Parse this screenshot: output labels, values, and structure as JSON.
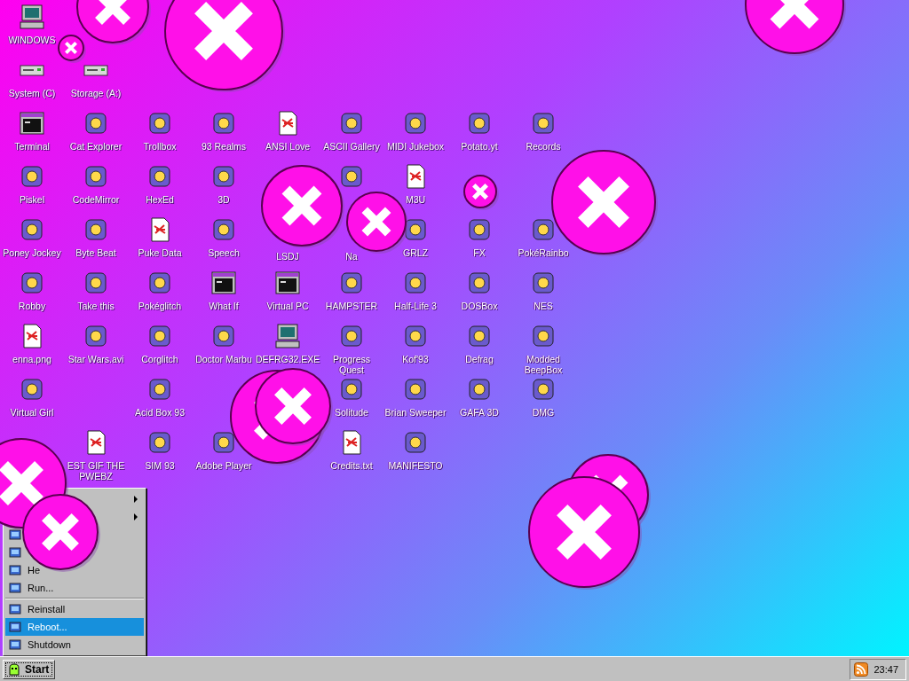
{
  "desktop": {
    "rows": [
      [
        {
          "label": "WINDOWS",
          "kind": "computer"
        }
      ],
      [
        {
          "label": "System (C)",
          "kind": "drive"
        },
        {
          "label": "Storage (A:)",
          "kind": "drive"
        }
      ],
      [
        {
          "label": "Terminal",
          "kind": "window"
        },
        {
          "label": "Cat Explorer",
          "kind": "app"
        },
        {
          "label": "Trollbox",
          "kind": "app"
        },
        {
          "label": "93 Realms",
          "kind": "app"
        },
        {
          "label": "ANSI Love",
          "kind": "document"
        },
        {
          "label": "ASCII Gallery",
          "kind": "app"
        },
        {
          "label": "MIDI Jukebox",
          "kind": "app"
        },
        {
          "label": "Potato.yt",
          "kind": "app"
        },
        {
          "label": "Records",
          "kind": "app"
        }
      ],
      [
        {
          "label": "Piskel",
          "kind": "app"
        },
        {
          "label": "CodeMirror",
          "kind": "app"
        },
        {
          "label": "HexEd",
          "kind": "app"
        },
        {
          "label": "3D",
          "kind": "app"
        },
        null,
        {
          "kind": "app"
        },
        {
          "label": "M3U",
          "kind": "document"
        },
        null,
        null
      ],
      [
        {
          "label": "Poney Jockey",
          "kind": "app"
        },
        {
          "label": "Byte Beat",
          "kind": "app"
        },
        {
          "label": "Puke Data",
          "kind": "document"
        },
        {
          "label": "Speech",
          "kind": "app"
        },
        {
          "label": "LSDJ",
          "kind": "none"
        },
        {
          "label": "Na",
          "kind": "none"
        },
        {
          "label": "GRLZ",
          "kind": "app"
        },
        {
          "label": "FX",
          "kind": "app"
        },
        {
          "label": "PokéRainbo",
          "kind": "app"
        }
      ],
      [
        {
          "label": "Robby",
          "kind": "app"
        },
        {
          "label": "Take this",
          "kind": "app"
        },
        {
          "label": "Pokéglitch",
          "kind": "app"
        },
        {
          "label": "What If",
          "kind": "window"
        },
        {
          "label": "Virtual PC",
          "kind": "window"
        },
        {
          "label": "HAMPSTER",
          "kind": "app"
        },
        {
          "label": "Half-Life 3",
          "kind": "app"
        },
        {
          "label": "DOSBox",
          "kind": "app"
        },
        {
          "label": "NES",
          "kind": "app"
        }
      ],
      [
        {
          "label": "enna.png",
          "kind": "document"
        },
        {
          "label": "Star Wars.avi",
          "kind": "app"
        },
        {
          "label": "Corglitch",
          "kind": "app"
        },
        {
          "label": "Doctor Marbu",
          "kind": "app"
        },
        {
          "label": "DEFRG32.EXE",
          "kind": "computer"
        },
        {
          "label": "Progress Quest",
          "kind": "app"
        },
        {
          "label": "Kof'93",
          "kind": "app"
        },
        {
          "label": "Defrag",
          "kind": "app"
        },
        {
          "label": "Modded BeepBox",
          "kind": "app"
        }
      ],
      [
        {
          "label": "Virtual Girl",
          "kind": "app"
        },
        null,
        {
          "label": "Acid Box 93",
          "kind": "app"
        },
        null,
        null,
        {
          "label": "Solitude",
          "kind": "app"
        },
        {
          "label": "Brian Sweeper",
          "kind": "app"
        },
        {
          "label": "GAFA 3D",
          "kind": "app"
        },
        {
          "label": "DMG",
          "kind": "app"
        }
      ],
      [
        null,
        {
          "label": "EST GIF THE PWEBZ",
          "kind": "document"
        },
        {
          "label": "SIM 93",
          "kind": "app"
        },
        {
          "label": "Adobe Player",
          "kind": "app"
        },
        null,
        {
          "label": "Credits.txt",
          "kind": "document"
        },
        {
          "label": "MANIFESTO",
          "kind": "app"
        }
      ]
    ]
  },
  "start_menu": {
    "items": [
      {
        "kind": "item",
        "submenu": true,
        "selected": false
      },
      {
        "kind": "item",
        "submenu": true,
        "selected": false
      },
      {
        "kind": "item",
        "submenu": false,
        "selected": false
      },
      {
        "kind": "item",
        "submenu": false,
        "selected": false
      },
      {
        "kind": "item",
        "label": "He",
        "submenu": false,
        "selected": false
      },
      {
        "kind": "item",
        "label": "Run...",
        "submenu": false,
        "selected": false
      },
      {
        "kind": "separator"
      },
      {
        "kind": "item",
        "label": "Reinstall",
        "submenu": false,
        "selected": false
      },
      {
        "kind": "item",
        "label": "Reboot...",
        "submenu": false,
        "selected": true
      },
      {
        "kind": "item",
        "label": "Shutdown",
        "submenu": false,
        "selected": false
      }
    ]
  },
  "taskbar": {
    "start_label": "Start",
    "clock": "23:47"
  }
}
